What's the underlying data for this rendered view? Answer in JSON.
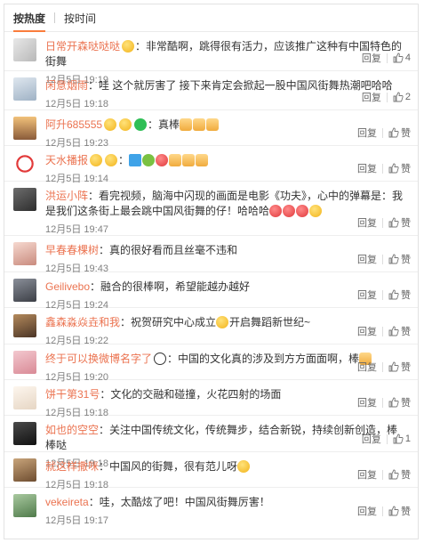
{
  "tabs": {
    "hot": "按热度",
    "time": "按时间"
  },
  "actions": {
    "reply": "回复",
    "like": "赞"
  },
  "colors": {
    "accent": "#fa7d3c",
    "username": "#eb7350"
  },
  "comments": [
    {
      "user": "日常开森哒哒哒",
      "text": "：非常酷啊，跳得很有活力，应该推广这种有中国特色的街舞",
      "time": "12月5日 19:19",
      "likes": "4"
    },
    {
      "user": "闲意烟雨",
      "text": "：哇 这个就厉害了 接下来肯定会掀起一股中国风街舞热潮吧哈哈",
      "time": "12月5日 19:18",
      "likes": "2"
    },
    {
      "user": "阿升685555",
      "text": "：真棒",
      "time": "12月5日 19:23",
      "likes": "赞"
    },
    {
      "user": "天水播报",
      "text": "：",
      "time": "12月5日 19:14",
      "likes": "赞"
    },
    {
      "user": "洪运小阵",
      "text": "：看完视频，脑海中闪现的画面是电影《功夫》，心中的弹幕是：我是我们这条街上最会跳中国风街舞的仔！哈哈哈",
      "time": "12月5日 19:47",
      "likes": "赞"
    },
    {
      "user": "早春春棵树",
      "text": "：真的很好看而且丝毫不违和",
      "time": "12月5日 19:43",
      "likes": "赞"
    },
    {
      "user": "Geilivebo",
      "text": "：融合的很棒啊，希望能越办越好",
      "time": "12月5日 19:24",
      "likes": "赞"
    },
    {
      "user": "鑫森淼焱垚和我",
      "text": "：祝贺研究中心成立",
      "text2": "开启舞蹈新世纪~",
      "time": "12月5日 19:22",
      "likes": "赞"
    },
    {
      "user": "终于可以换微博名字了",
      "text": "：中国的文化真的涉及到方方面面啊，棒",
      "time": "12月5日 19:20",
      "likes": "赞"
    },
    {
      "user": "饼干第31号",
      "text": "：文化的交融和碰撞，火花四射的场面",
      "time": "12月5日 19:18",
      "likes": "赞"
    },
    {
      "user": "如也的空空",
      "text": "：关注中国传统文化，传统舞步，结合新锐，持续创新创造，棒棒哒",
      "time": "12月5日 19:18",
      "likes": "1"
    },
    {
      "user": "就这样撒咪",
      "text": "：中国风的街舞，很有范儿呀",
      "time": "12月5日 19:18",
      "likes": "赞"
    },
    {
      "user": "vekeireta",
      "text": "：哇，太酷炫了吧！中国风街舞厉害！",
      "time": "12月5日 19:17",
      "likes": "赞"
    }
  ]
}
